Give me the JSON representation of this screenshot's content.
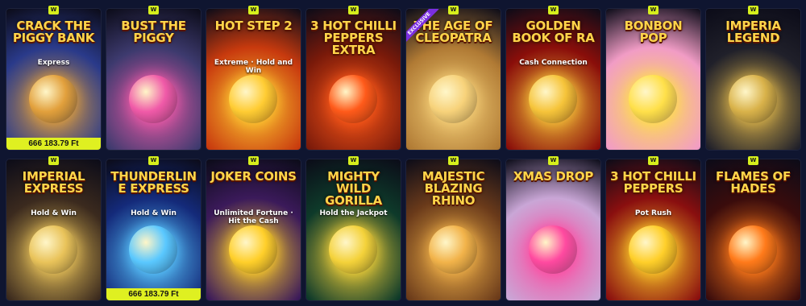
{
  "badge_label": "W",
  "tiles": [
    {
      "title": "Crack the Piggy Bank",
      "subtitle": "Express",
      "jackpot": "666 183.79 Ft",
      "bg": "#2a3a8a",
      "accent": "#e2a03c"
    },
    {
      "title": "Bust the Piggy",
      "subtitle": "",
      "jackpot": "",
      "bg": "#3d3a6e",
      "accent": "#f05aa8"
    },
    {
      "title": "Hot Step 2",
      "subtitle": "Extreme · Hold and Win",
      "jackpot": "",
      "bg": "#c83a0e",
      "accent": "#ffcc33"
    },
    {
      "title": "3 Hot Chilli Peppers Extra",
      "subtitle": "",
      "jackpot": "",
      "bg": "#7a1a0a",
      "accent": "#ff5a1a"
    },
    {
      "title": "The Age of Cleopatra",
      "subtitle": "",
      "jackpot": "",
      "bg": "#b07a34",
      "accent": "#f7d27a",
      "exclusive": "EXCLUSIVE"
    },
    {
      "title": "Golden Book of Ra",
      "subtitle": "Cash Connection",
      "jackpot": "",
      "bg": "#8a0e0a",
      "accent": "#f6c43a"
    },
    {
      "title": "Bonbon Pop",
      "subtitle": "",
      "jackpot": "",
      "bg": "#f19cc5",
      "accent": "#ffe04a"
    },
    {
      "title": "Imperia Legend",
      "subtitle": "",
      "jackpot": "",
      "bg": "#20202a",
      "accent": "#d9b24a"
    },
    {
      "title": "Imperial Express",
      "subtitle": "Hold & Win",
      "jackpot": "",
      "bg": "#3b2a1e",
      "accent": "#e9c35a"
    },
    {
      "title": "Thunderline Express",
      "subtitle": "Hold & Win",
      "jackpot": "666 183.79 Ft",
      "bg": "#142a7a",
      "accent": "#5ac8ff"
    },
    {
      "title": "Joker Coins",
      "subtitle": "Unlimited Fortune · Hit the Cash",
      "jackpot": "",
      "bg": "#3b1a5a",
      "accent": "#ffcf2a"
    },
    {
      "title": "Mighty Wild Gorilla",
      "subtitle": "Hold the Jackpot",
      "jackpot": "",
      "bg": "#0e3a2a",
      "accent": "#f4d23a"
    },
    {
      "title": "Majestic Blazing Rhino",
      "subtitle": "",
      "jackpot": "",
      "bg": "#6a3a1a",
      "accent": "#f2b34a"
    },
    {
      "title": "Xmas Drop",
      "subtitle": "",
      "jackpot": "",
      "bg": "#c9a6d6",
      "accent": "#ff4aa0"
    },
    {
      "title": "3 Hot Chilli Peppers",
      "subtitle": "Pot Rush",
      "jackpot": "",
      "bg": "#8a0f0f",
      "accent": "#ffcf2a"
    },
    {
      "title": "Flames of Hades",
      "subtitle": "",
      "jackpot": "",
      "bg": "#3a0c0c",
      "accent": "#ff7a1a"
    }
  ]
}
